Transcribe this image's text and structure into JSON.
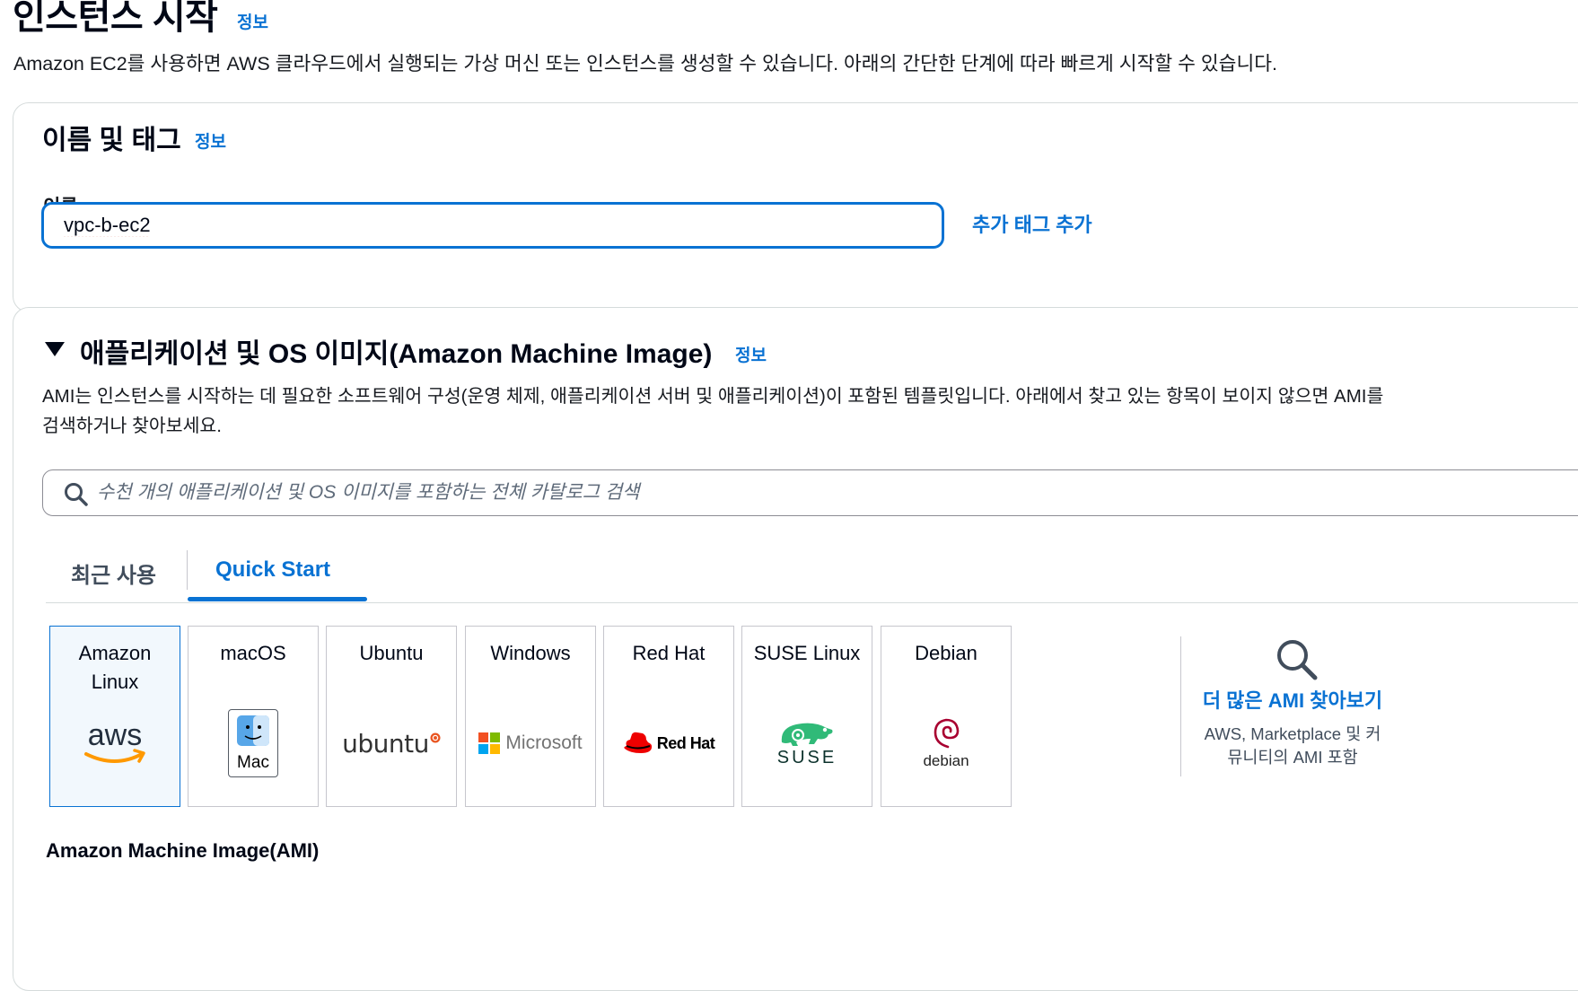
{
  "header": {
    "title": "인스턴스 시작",
    "info": "정보",
    "description": "Amazon EC2를 사용하면 AWS 클라우드에서 실행되는 가상 머신 또는 인스턴스를 생성할 수 있습니다. 아래의 간단한 단계에 따라 빠르게 시작할 수 있습니다."
  },
  "name_tags": {
    "title": "이름 및 태그",
    "info": "정보",
    "name_label": "이름",
    "name_value": "vpc-b-ec2",
    "add_tag": "추가 태그 추가"
  },
  "ami": {
    "title": "애플리케이션 및 OS 이미지(Amazon Machine Image)",
    "info": "정보",
    "description": "AMI는 인스턴스를 시작하는 데 필요한 소프트웨어 구성(운영 체제, 애플리케이션 서버 및 애플리케이션)이 포함된 템플릿입니다. 아래에서 찾고 있는 항목이 보이지 않으면 AMI를 검색하거나 찾아보세요.",
    "search_placeholder": "수천 개의 애플리케이션 및 OS 이미지를 포함하는 전체 카탈로그 검색",
    "tabs": [
      {
        "label": "최근 사용",
        "active": false
      },
      {
        "label": "Quick Start",
        "active": true
      }
    ],
    "os_cards": [
      {
        "name": "Amazon Linux",
        "logo": "aws-logo",
        "logo_text": "aws",
        "selected": true
      },
      {
        "name": "macOS",
        "logo": "mac-finder-logo",
        "logo_text": "Mac",
        "selected": false
      },
      {
        "name": "Ubuntu",
        "logo": "ubuntu-logo",
        "logo_text": "ubuntu",
        "selected": false
      },
      {
        "name": "Windows",
        "logo": "microsoft-logo",
        "logo_text": "Microsoft",
        "selected": false
      },
      {
        "name": "Red Hat",
        "logo": "redhat-logo",
        "logo_text": "Red Hat",
        "selected": false
      },
      {
        "name": "SUSE Linux",
        "logo": "suse-logo",
        "logo_text": "SUSE",
        "selected": false
      },
      {
        "name": "Debian",
        "logo": "debian-logo",
        "logo_text": "debian",
        "selected": false
      }
    ],
    "browse_more": {
      "label": "더 많은 AMI 찾아보기",
      "sub": "AWS, Marketplace 및 커뮤니티의 AMI 포함"
    },
    "sub_heading": "Amazon Machine Image(AMI)"
  },
  "colors": {
    "accent": "#0972d3",
    "selected_bg": "#f2f8fd",
    "aws_orange": "#ff9900",
    "ubuntu_orange": "#e95420",
    "redhat_red": "#ee0000",
    "suse_green": "#30ba78",
    "debian_red": "#a80030"
  }
}
